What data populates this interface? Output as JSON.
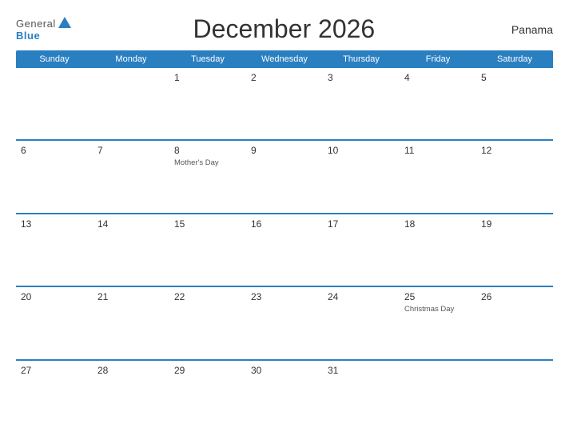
{
  "header": {
    "logo_general": "General",
    "logo_blue": "Blue",
    "title": "December 2026",
    "country": "Panama"
  },
  "day_headers": [
    "Sunday",
    "Monday",
    "Tuesday",
    "Wednesday",
    "Thursday",
    "Friday",
    "Saturday"
  ],
  "weeks": [
    [
      {
        "date": "",
        "holiday": ""
      },
      {
        "date": "",
        "holiday": ""
      },
      {
        "date": "1",
        "holiday": ""
      },
      {
        "date": "2",
        "holiday": ""
      },
      {
        "date": "3",
        "holiday": ""
      },
      {
        "date": "4",
        "holiday": ""
      },
      {
        "date": "5",
        "holiday": ""
      }
    ],
    [
      {
        "date": "6",
        "holiday": ""
      },
      {
        "date": "7",
        "holiday": ""
      },
      {
        "date": "8",
        "holiday": "Mother's Day"
      },
      {
        "date": "9",
        "holiday": ""
      },
      {
        "date": "10",
        "holiday": ""
      },
      {
        "date": "11",
        "holiday": ""
      },
      {
        "date": "12",
        "holiday": ""
      }
    ],
    [
      {
        "date": "13",
        "holiday": ""
      },
      {
        "date": "14",
        "holiday": ""
      },
      {
        "date": "15",
        "holiday": ""
      },
      {
        "date": "16",
        "holiday": ""
      },
      {
        "date": "17",
        "holiday": ""
      },
      {
        "date": "18",
        "holiday": ""
      },
      {
        "date": "19",
        "holiday": ""
      }
    ],
    [
      {
        "date": "20",
        "holiday": ""
      },
      {
        "date": "21",
        "holiday": ""
      },
      {
        "date": "22",
        "holiday": ""
      },
      {
        "date": "23",
        "holiday": ""
      },
      {
        "date": "24",
        "holiday": ""
      },
      {
        "date": "25",
        "holiday": "Christmas Day"
      },
      {
        "date": "26",
        "holiday": ""
      }
    ],
    [
      {
        "date": "27",
        "holiday": ""
      },
      {
        "date": "28",
        "holiday": ""
      },
      {
        "date": "29",
        "holiday": ""
      },
      {
        "date": "30",
        "holiday": ""
      },
      {
        "date": "31",
        "holiday": ""
      },
      {
        "date": "",
        "holiday": ""
      },
      {
        "date": "",
        "holiday": ""
      }
    ]
  ],
  "colors": {
    "accent": "#2a7fc1"
  }
}
